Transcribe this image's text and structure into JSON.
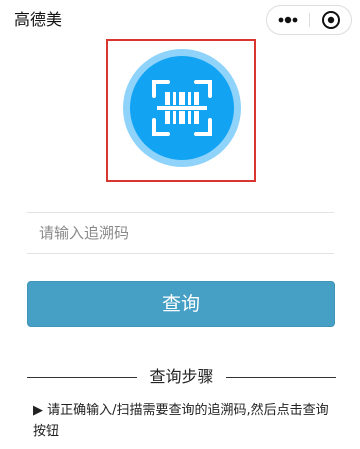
{
  "navbar": {
    "title": "高德美",
    "more_icon": "more-dots-icon",
    "close_icon": "target-circle-icon"
  },
  "scanner": {
    "icon": "barcode-scan-icon",
    "colors": {
      "frame": "#d9362f",
      "circle": "#12a3f2",
      "halo": "#8fd3fb"
    }
  },
  "search": {
    "placeholder": "请输入追溯码",
    "value": ""
  },
  "query_button": {
    "label": "查询",
    "color": "#46a0c6"
  },
  "steps": {
    "title": "查询步骤",
    "text": "▶ 请正确输入/扫描需要查询的追溯码,然后点击查询按钮"
  }
}
